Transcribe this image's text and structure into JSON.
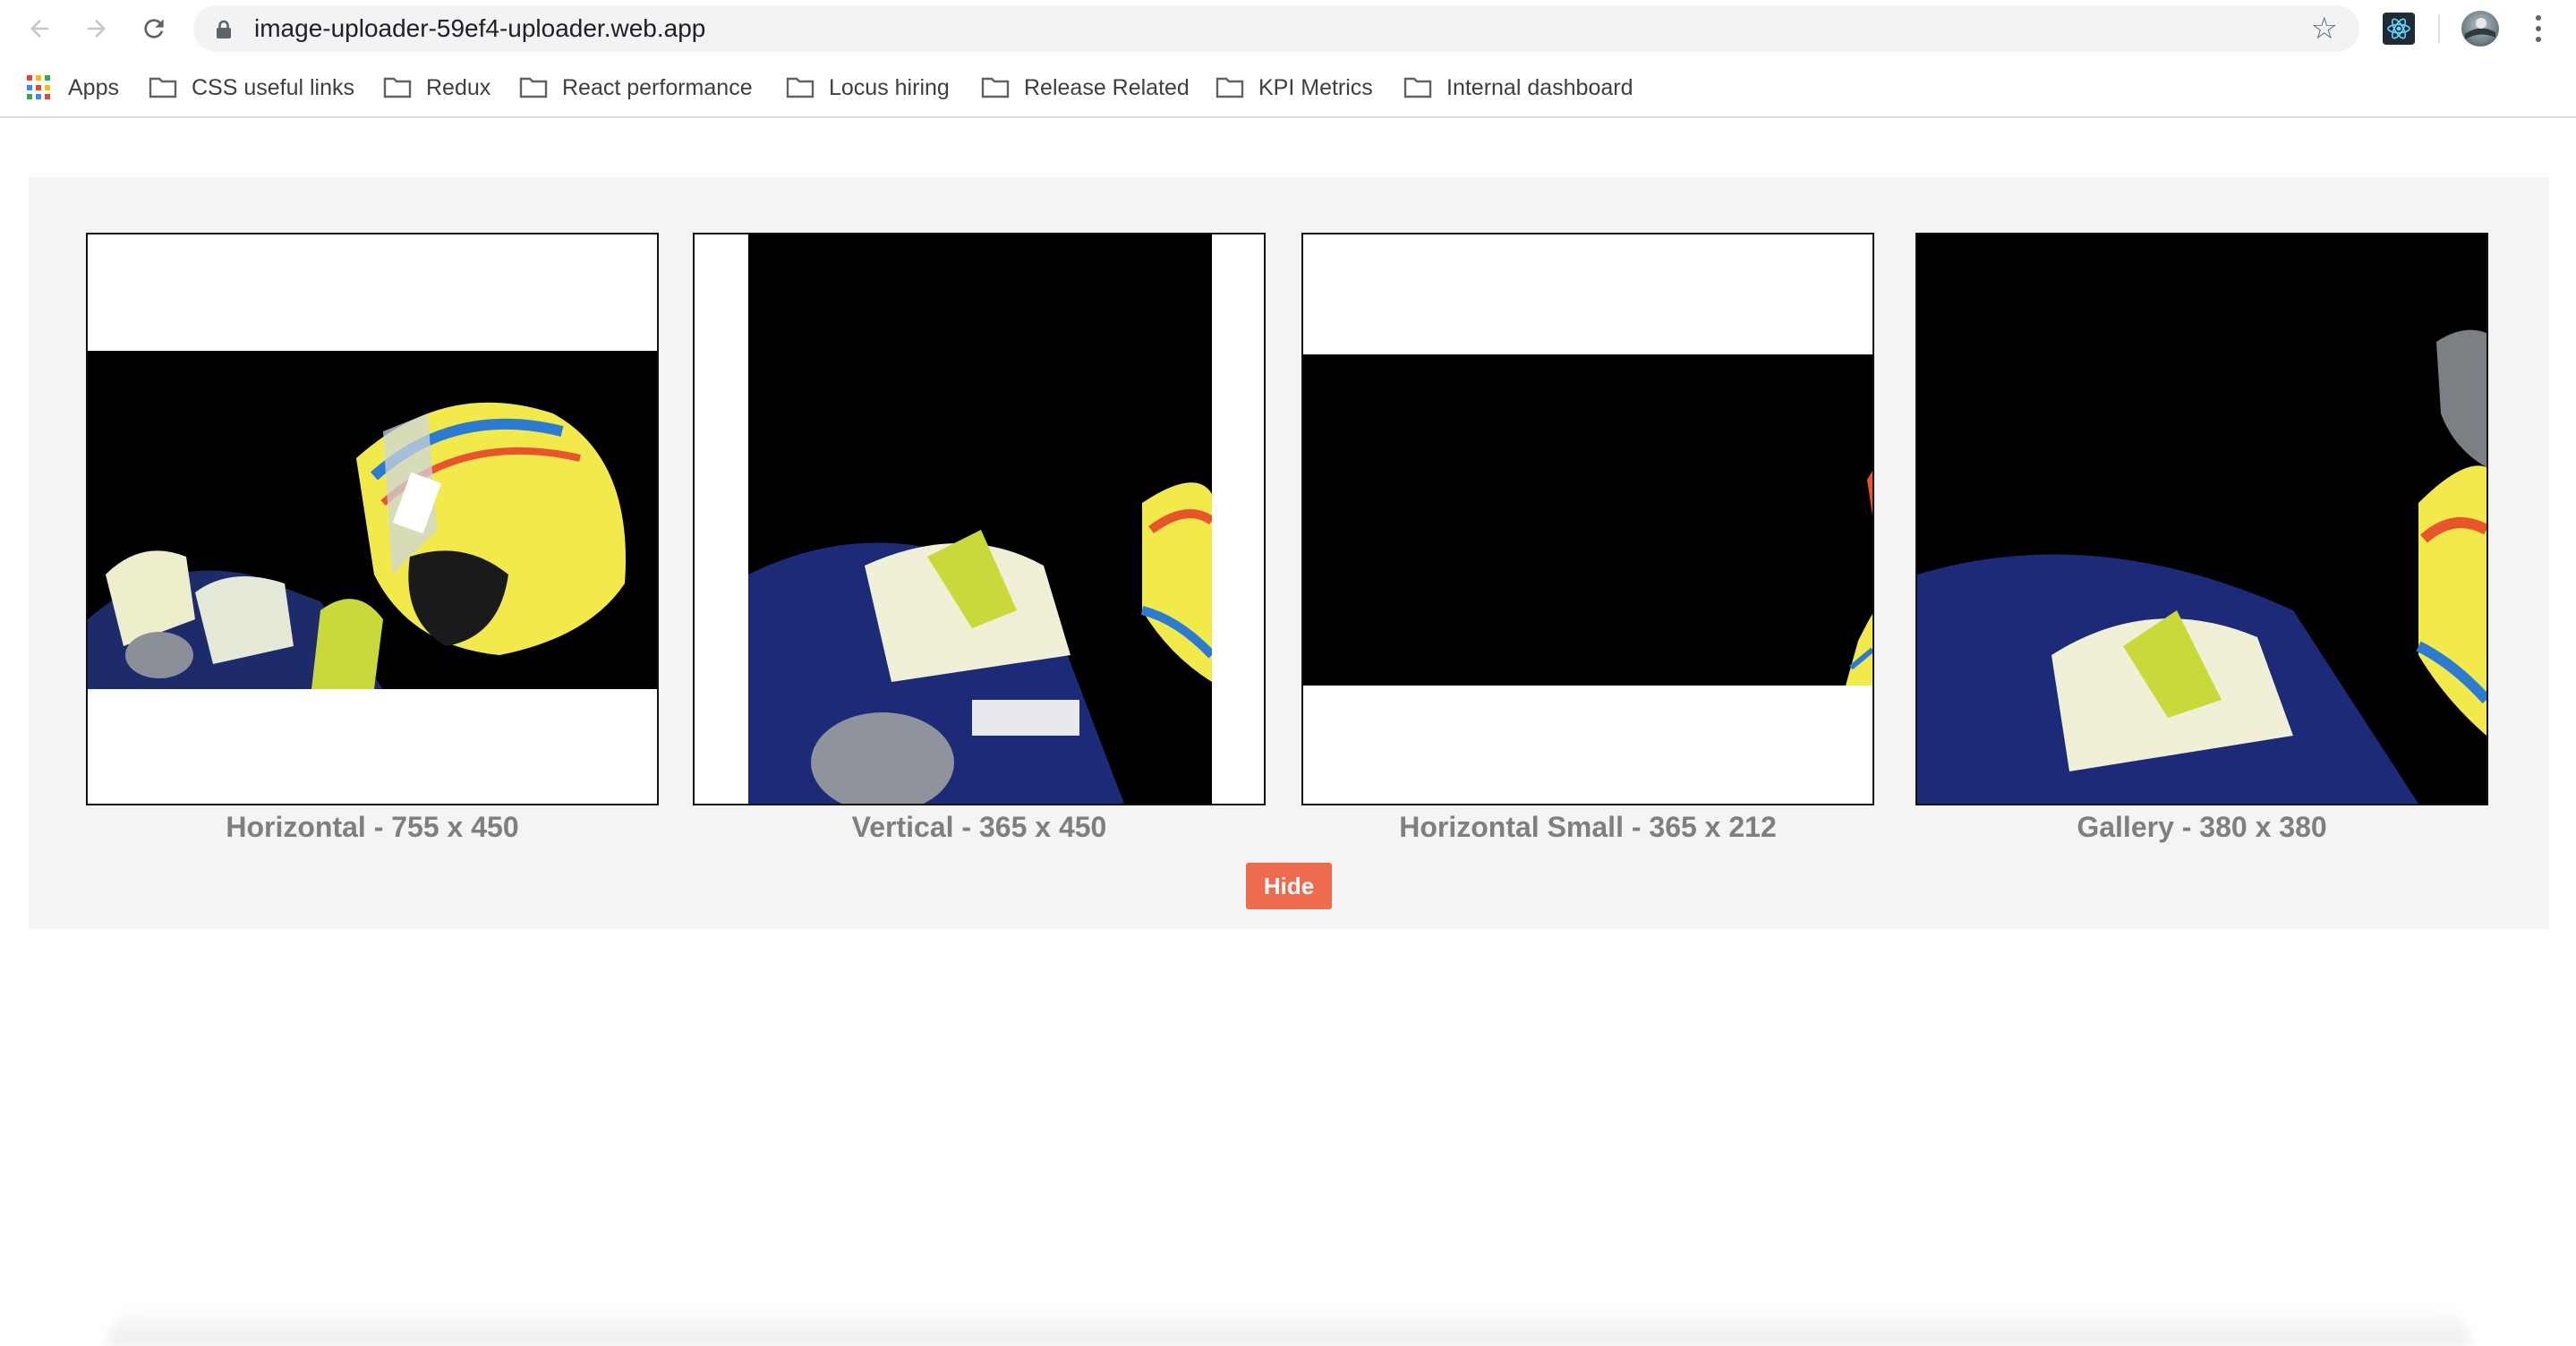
{
  "browser": {
    "url": "image-uploader-59ef4-uploader.web.app",
    "nav_icons": [
      "back-arrow-icon",
      "forward-arrow-icon",
      "reload-icon",
      "lock-icon",
      "bookmark-star-icon",
      "react-devtools-icon",
      "profile-avatar",
      "menu-dots-icon"
    ]
  },
  "bookmarks": {
    "apps_label": "Apps",
    "items": [
      {
        "label": "CSS useful links"
      },
      {
        "label": "Redux"
      },
      {
        "label": "React performance"
      },
      {
        "label": "Locus hiring"
      },
      {
        "label": "Release Related"
      },
      {
        "label": "KPI Metrics"
      },
      {
        "label": "Internal dashboard"
      }
    ]
  },
  "previews": [
    {
      "caption": "Horizontal - 755 x 450"
    },
    {
      "caption": "Vertical - 365 x 450"
    },
    {
      "caption": "Horizontal Small - 365 x 212"
    },
    {
      "caption": "Gallery - 380 x 380"
    }
  ],
  "hide_button": "Hide",
  "colors": {
    "panel_bg": "#f4f4f4",
    "caption": "#7f7f7f",
    "button_bg": "#ee6b4d",
    "button_text": "#ffffff"
  }
}
